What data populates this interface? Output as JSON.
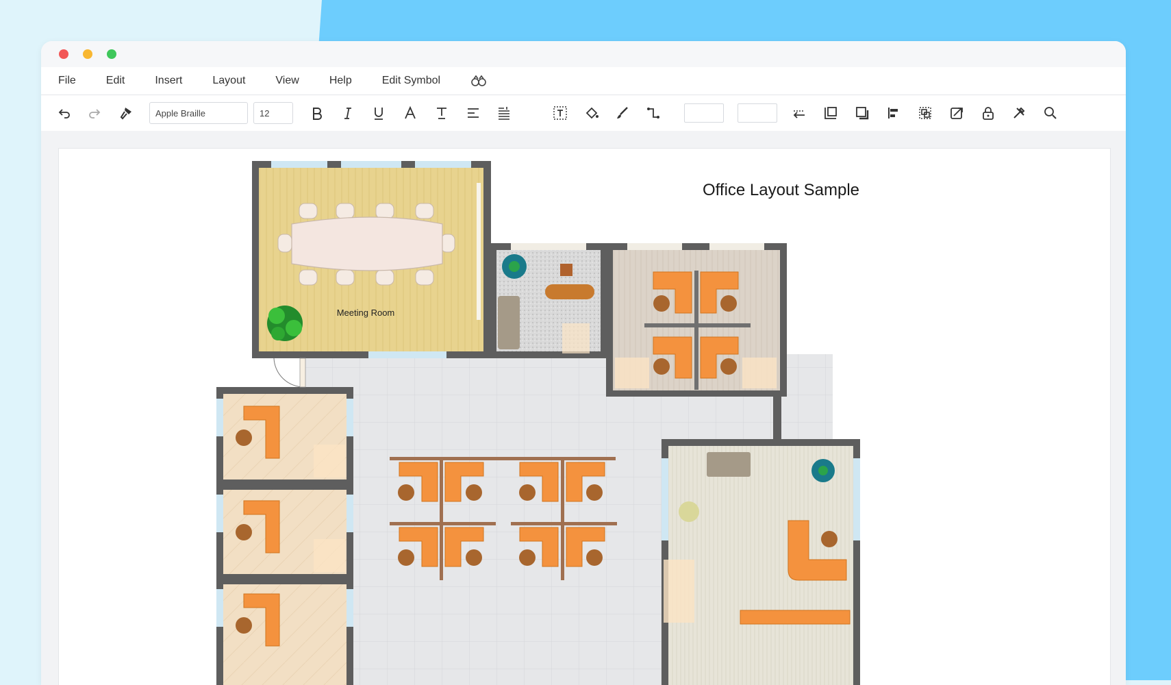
{
  "window": {
    "menu": [
      "File",
      "Edit",
      "Insert",
      "Layout",
      "View",
      "Help",
      "Edit Symbol"
    ]
  },
  "toolbar": {
    "font_family": "Apple Braille",
    "font_size": "12"
  },
  "diagram": {
    "title": "Office Layout Sample",
    "rooms": {
      "meeting_room": "Meeting Room"
    }
  },
  "colors": {
    "background_accent": "#6dcdfd",
    "close": "#f25757",
    "minimize": "#f8b732",
    "maximize": "#3fc75b",
    "wall": "#5e5e5e",
    "desk": "#f4923e",
    "chair": "#a8662e",
    "meeting_floor": "#e8d38e"
  },
  "icons": {
    "menu_extra": "binoculars-icon",
    "toolbar": [
      "undo-icon",
      "redo-icon",
      "format-painter-icon",
      "bold-icon",
      "italic-icon",
      "underline-icon",
      "font-color-icon",
      "text-style-icon",
      "align-icon",
      "line-spacing-icon",
      "text-box-icon",
      "fill-icon",
      "line-icon",
      "connector-icon",
      "arrow-style-icon",
      "bring-front-icon",
      "shadow-icon",
      "align-objects-icon",
      "group-icon",
      "rotate-icon",
      "lock-icon",
      "tools-icon",
      "search-icon"
    ]
  }
}
